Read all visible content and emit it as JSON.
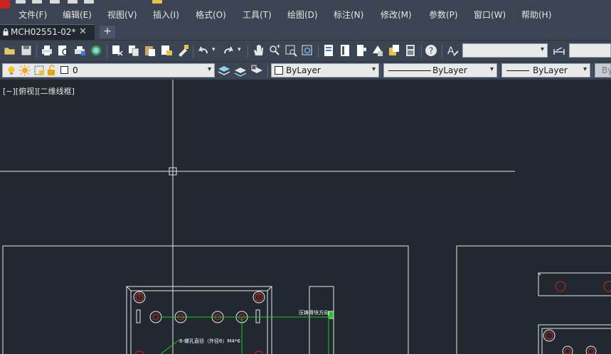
{
  "menu": {
    "items": [
      "文件(F)",
      "编辑(E)",
      "视图(V)",
      "插入(I)",
      "格式(O)",
      "工具(T)",
      "绘图(D)",
      "标注(N)",
      "修改(M)",
      "参数(P)",
      "窗口(W)",
      "帮助(H)"
    ]
  },
  "tabs": {
    "active_title": "MCH02551-02*",
    "close_glyph": "✕",
    "add_glyph": "+"
  },
  "toolbar": {
    "layer_value": "0",
    "text_style_value": "",
    "color_value": "ByLayer",
    "linetype_value": "ByLayer",
    "lineweight_value": "ByLayer",
    "plotstyle_value": "By"
  },
  "canvas": {
    "view_label": "[−][俯视][二维线框]",
    "annotation_1": "压铸滑块方向",
    "annotation_2": "8-螺孔直径（外径6）M4*6"
  },
  "colors": {
    "background": "#212830",
    "ui_panel": "#3b4453",
    "drawing_white": "#ffffff",
    "drawing_green": "#1ec81e",
    "drawing_red": "#e02020"
  },
  "icons": [
    "app-logo-icon",
    "lock-icon",
    "open-icon",
    "save-icon",
    "print-icon",
    "preview-icon",
    "plot-icon",
    "publish-icon",
    "cut-icon",
    "copy-icon",
    "paste-icon",
    "match-prop-icon",
    "undo-icon",
    "redo-icon",
    "pan-icon",
    "zoom-realtime-icon",
    "zoom-window-icon",
    "zoom-previous-icon",
    "properties-icon",
    "design-center-icon",
    "tool-palettes-icon",
    "sheet-set-icon",
    "markup-icon",
    "calculator-icon",
    "help-icon",
    "text-style-icon",
    "dim-style-icon",
    "light-bulb-icon",
    "sun-icon",
    "freeze-icon",
    "lock-open-icon",
    "layer-states-icon"
  ]
}
